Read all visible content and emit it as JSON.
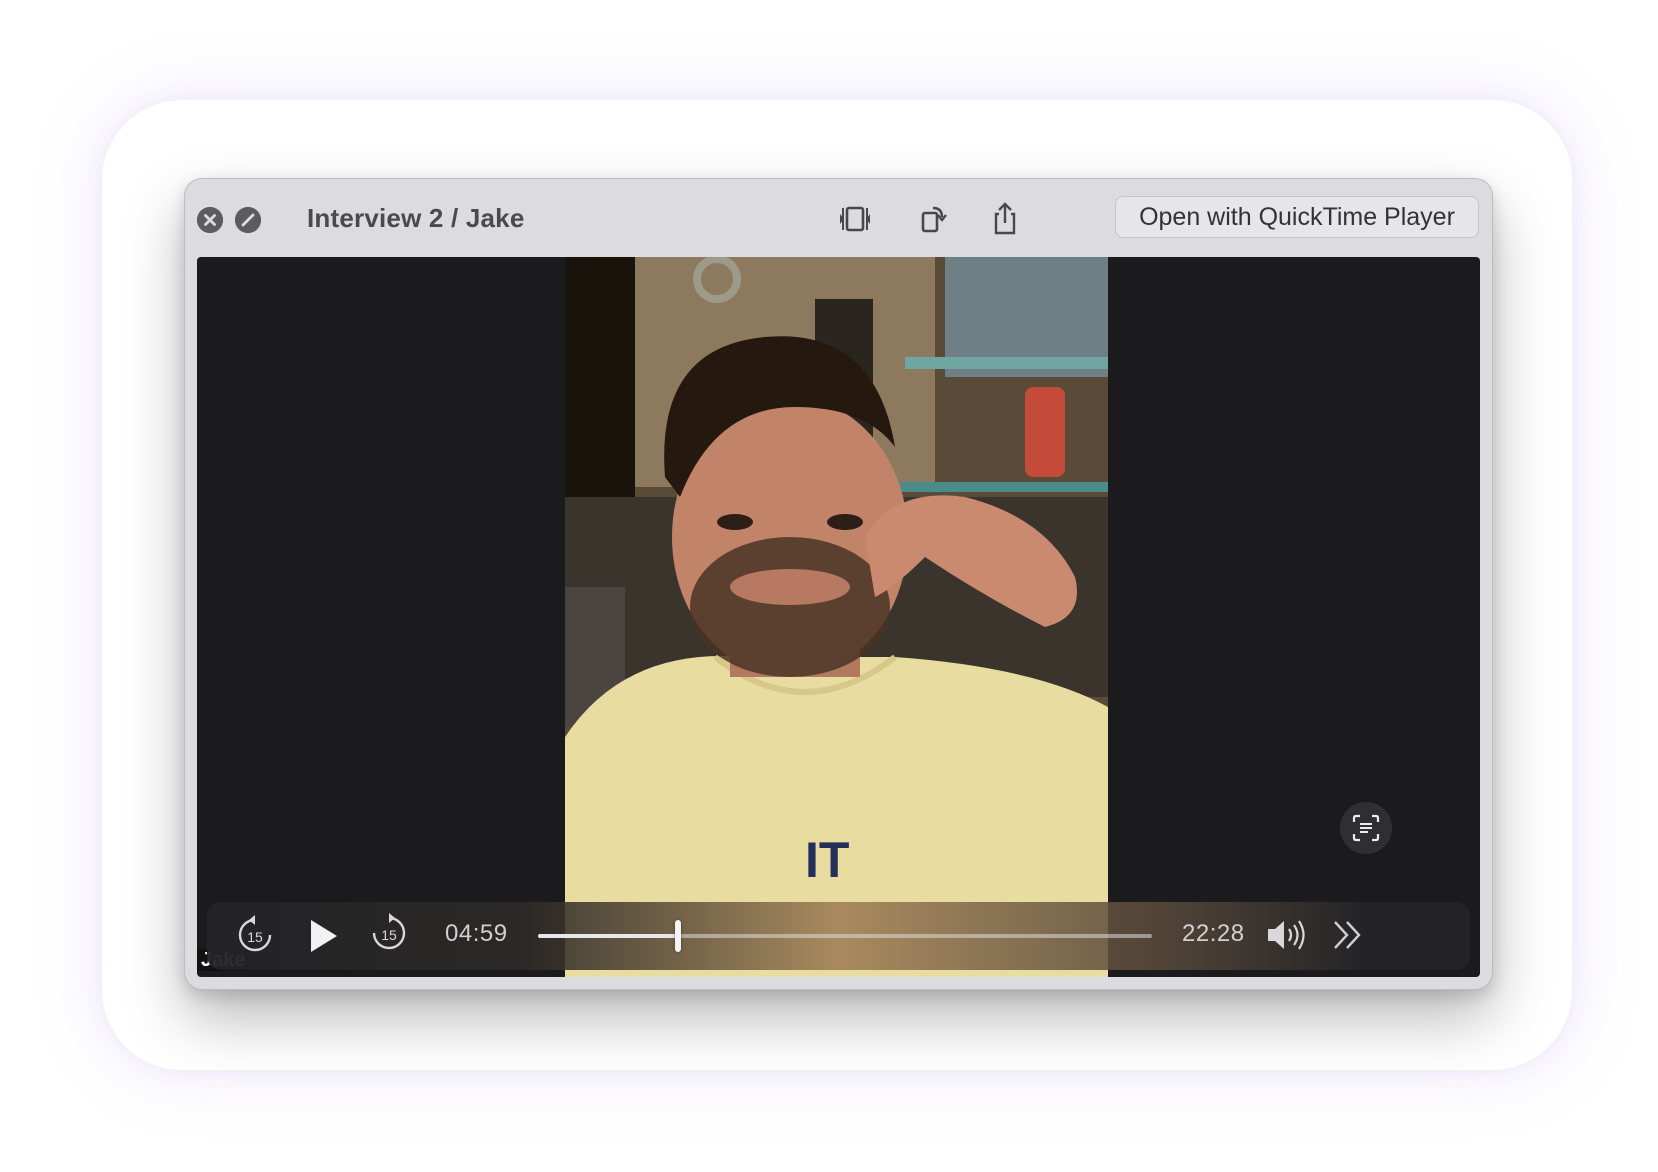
{
  "window": {
    "title": "Interview 2 / Jake",
    "open_with_label": "Open with QuickTime Player"
  },
  "toolbar_icons": [
    "trim-icon",
    "rotate-icon",
    "share-icon"
  ],
  "player": {
    "current_time": "04:59",
    "total_time": "22:28",
    "progress": 0.228,
    "skip_back_label": "15",
    "skip_forward_label": "15",
    "caption_partial": "Jake"
  },
  "colors": {
    "window_bg": "#dcdbe0",
    "video_bg": "#1b1b1d",
    "accent_shirt": "#e8dca0"
  }
}
